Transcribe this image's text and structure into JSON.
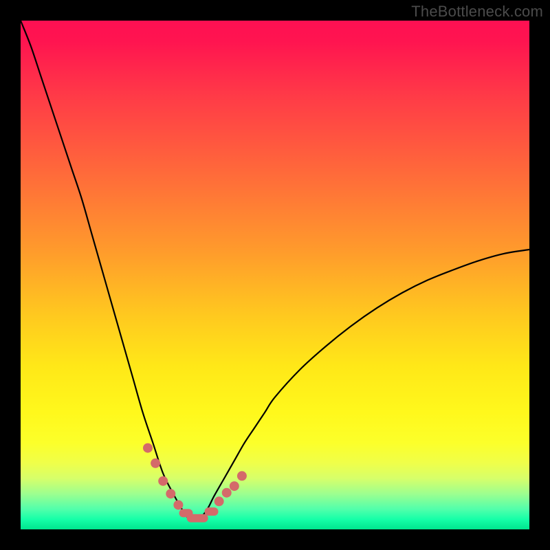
{
  "watermark": "TheBottleneck.com",
  "chart_data": {
    "type": "line",
    "title": "",
    "xlabel": "",
    "ylabel": "",
    "xlim": [
      0,
      100
    ],
    "ylim": [
      0,
      100
    ],
    "grid": false,
    "legend": false,
    "description": "Bottleneck curve: V-shaped profile with minimum near x≈33 dipping to ~2% then rising toward the right edge to ~55%. Background is a vertical heat gradient (red→yellow→green) representing bottleneck severity (top=worst, bottom=optimal).",
    "x": [
      0,
      2,
      4,
      6,
      8,
      10,
      12,
      14,
      16,
      18,
      20,
      22,
      24,
      26,
      28,
      30,
      32,
      33,
      34,
      35,
      36,
      37,
      38,
      40,
      42,
      44,
      46,
      48,
      50,
      55,
      60,
      65,
      70,
      75,
      80,
      85,
      90,
      95,
      100
    ],
    "y": [
      100,
      95,
      89,
      83,
      77,
      71,
      65,
      58,
      51,
      44,
      37,
      30,
      23,
      17,
      11,
      7,
      3.5,
      2.2,
      2,
      2.2,
      3,
      4.5,
      6.5,
      10,
      13.5,
      17,
      20,
      23,
      26,
      31.5,
      36,
      40,
      43.5,
      46.5,
      49,
      51,
      52.8,
      54.2,
      55
    ],
    "markers": {
      "comment": "Coral dots/dashes near the valley region",
      "points_x": [
        25,
        26.5,
        28,
        29.5,
        31,
        32.5,
        34,
        35.5,
        37.5,
        39,
        40.5,
        42,
        43.5
      ],
      "points_y": [
        16,
        13,
        9.5,
        7,
        4.8,
        3.2,
        2.2,
        2.2,
        3.5,
        5.5,
        7.2,
        8.5,
        10.5
      ]
    },
    "gradient_stops": [
      {
        "pct": 0,
        "color": "#ff1052"
      },
      {
        "pct": 15,
        "color": "#ff3b47"
      },
      {
        "pct": 30,
        "color": "#ff6a3a"
      },
      {
        "pct": 45,
        "color": "#ff9a2c"
      },
      {
        "pct": 58,
        "color": "#ffc91f"
      },
      {
        "pct": 77,
        "color": "#fff81c"
      },
      {
        "pct": 90,
        "color": "#d6ff6a"
      },
      {
        "pct": 100,
        "color": "#00e58e"
      }
    ],
    "marker_color": "#d46a6a",
    "line_color": "#000000"
  }
}
